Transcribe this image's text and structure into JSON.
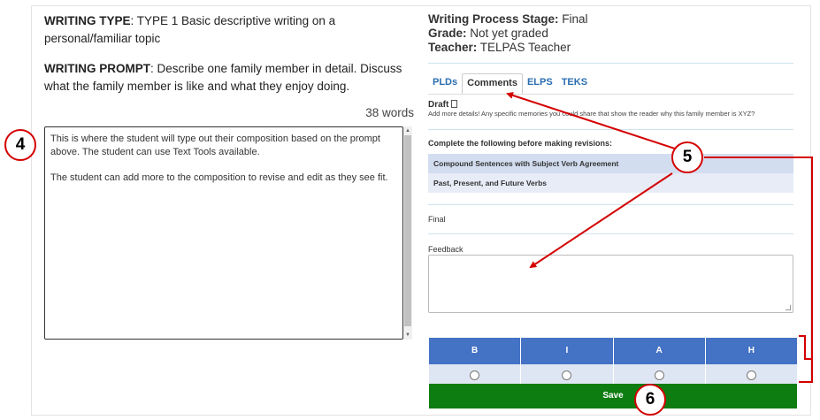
{
  "writing_type": {
    "label": "WRITING TYPE",
    "value": ": TYPE 1 Basic descriptive writing on a personal/familiar topic"
  },
  "writing_prompt": {
    "label": "WRITING PROMPT",
    "value": ": Describe one family member in detail. Discuss what the family member is like and what they enjoy doing."
  },
  "word_count": "38 words",
  "composition": {
    "paragraph1": "This is where the student will type out their composition based on the prompt above. The student can use Text Tools available.",
    "paragraph2": "The student can add more to the composition to revise and edit as they see fit."
  },
  "status": {
    "stage_label": "Writing Process Stage:",
    "stage_value": " Final",
    "grade_label": "Grade:",
    "grade_value": " Not yet graded",
    "teacher_label": "Teacher:",
    "teacher_value": " TELPAS Teacher"
  },
  "tabs": [
    {
      "label": "PLDs",
      "active": false
    },
    {
      "label": "Comments",
      "active": true
    },
    {
      "label": "ELPS",
      "active": false
    },
    {
      "label": "TEKS",
      "active": false
    }
  ],
  "draft": {
    "label": "Draft",
    "comment": "Add more details! Any specific memories you could share that show the reader why this family member is XYZ?"
  },
  "checklist": {
    "title": "Complete the following before making revisions:",
    "items": [
      "Compound Sentences with Subject Verb Agreement",
      "Past, Present, and Future Verbs"
    ]
  },
  "final_label": "Final",
  "feedback": {
    "label": "Feedback",
    "value": ""
  },
  "rubric": {
    "columns": [
      "B",
      "I",
      "A",
      "H"
    ]
  },
  "save_label": "Save",
  "callouts": {
    "c4": "4",
    "c5": "5",
    "c6": "6"
  },
  "colors": {
    "accent_blue": "#4472c4",
    "save_green": "#0e7d11",
    "callout_red": "#d40000",
    "link_blue": "#2a6db0"
  }
}
